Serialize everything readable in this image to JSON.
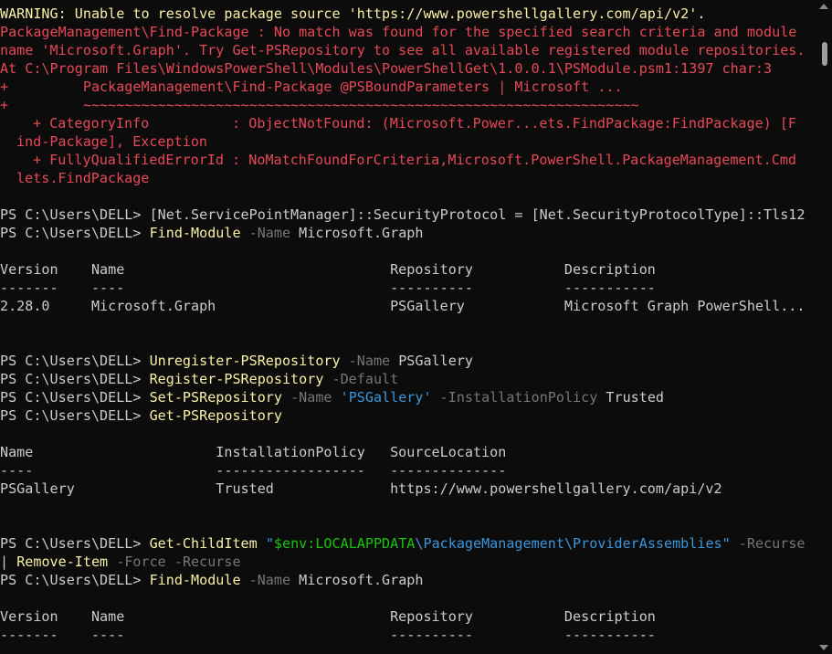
{
  "colors": {
    "background": "#0c0c0c",
    "text": "#cccccc",
    "warning": "#f9f1a5",
    "error": "#e74856",
    "command": "#f9f1a5",
    "parameter": "#767676",
    "string": "#3a96dd"
  },
  "error_block": {
    "warning": "WARNING: Unable to resolve package source 'https://www.powershellgallery.com/api/v2'.",
    "lines": [
      "PackageManagement\\Find-Package : No match was found for the specified search criteria and module",
      "name 'Microsoft.Graph'. Try Get-PSRepository to see all available registered module repositories.",
      "At C:\\Program Files\\WindowsPowerShell\\Modules\\PowerShellGet\\1.0.0.1\\PSModule.psm1:1397 char:3",
      "+         PackageManagement\\Find-Package @PSBoundParameters | Microsoft ...",
      "+         ~~~~~~~~~~~~~~~~~~~~~~~~~~~~~~~~~~~~~~~~~~~~~~~~~~~~~~~~~~~~~~~~~~~"
    ],
    "category_info": [
      "+ CategoryInfo          : ObjectNotFound: (Microsoft.Power...ets.FindPackage:FindPackage) [F",
      "ind-Package], Exception"
    ],
    "fq_error": [
      "+ FullyQualifiedErrorId : NoMatchFoundForCriteria,Microsoft.PowerShell.PackageManagement.Cmd",
      "lets.FindPackage"
    ]
  },
  "prompt": "PS C:\\Users\\DELL> ",
  "commands": {
    "c1": {
      "pre": "[Net.ServicePointManager]::SecurityProtocol = [Net.SecurityProtocolType]::Tls12"
    },
    "c2": {
      "cmd": "Find-Module",
      "p1": " -Name",
      "arg": " Microsoft.Graph"
    },
    "c3": {
      "cmd": "Unregister-PSRepository",
      "p1": " -Name",
      "arg": " PSGallery"
    },
    "c4": {
      "cmd": "Register-PSRepository",
      "p1": " -Default"
    },
    "c5": {
      "cmd": "Set-PSRepository",
      "p1": " -Name",
      "str": " 'PSGallery'",
      "p2": " -InstallationPolicy",
      "arg": " Trusted"
    },
    "c6": {
      "cmd": "Get-PSRepository"
    },
    "c7": {
      "cmd": "Get-ChildItem",
      "sp": " ",
      "s1": "\"",
      "var": "$env:LOCALAPPDATA",
      "path": "\\PackageManagement\\ProviderAssemblies",
      "s2": "\"",
      "p1": " -Recurse",
      "pipe": "| ",
      "cmd2": "Remove-Item",
      "p2": " -Force",
      "p3": " -Recurse"
    },
    "c8": {
      "cmd": "Find-Module",
      "p1": " -Name",
      "arg": " Microsoft.Graph"
    }
  },
  "find_module_table_1": {
    "header": "Version    Name                                Repository           Description",
    "sep": "-------    ----                                ----------           -----------",
    "rows": [
      "2.28.0     Microsoft.Graph                     PSGallery            Microsoft Graph PowerShell..."
    ]
  },
  "repo_table": {
    "header": "Name                      InstallationPolicy   SourceLocation",
    "sep": "----                      ------------------   --------------",
    "rows": [
      "PSGallery                 Trusted              https://www.powershellgallery.com/api/v2"
    ]
  },
  "find_module_table_2": {
    "header": "Version    Name                                Repository           Description",
    "sep": "-------    ----                                ----------           -----------"
  }
}
